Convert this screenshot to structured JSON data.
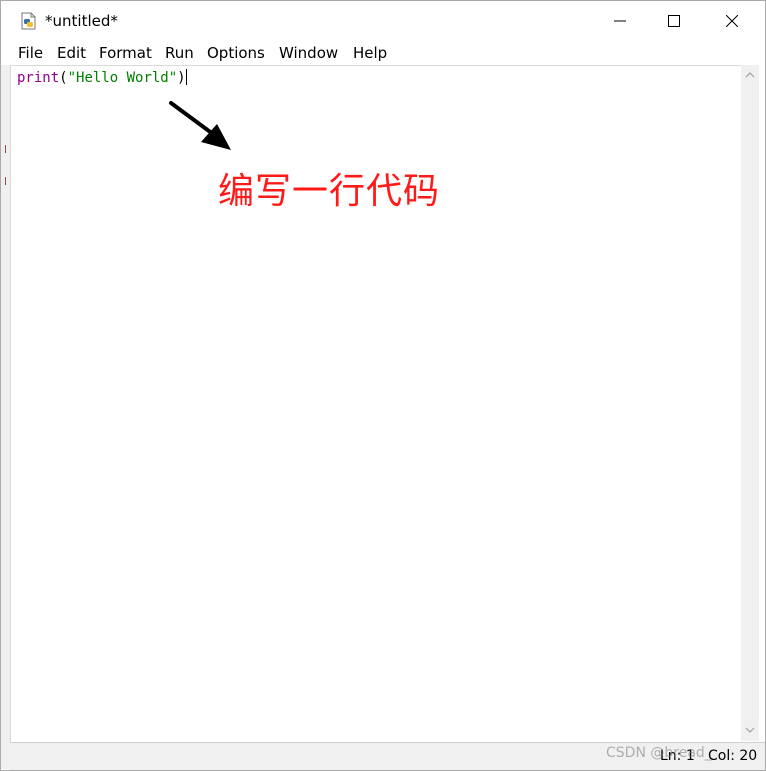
{
  "window": {
    "title": "*untitled*",
    "icon": "python-file-icon"
  },
  "window_controls": {
    "minimize": "minimize-icon",
    "maximize": "maximize-icon",
    "close": "close-icon"
  },
  "menubar": {
    "items": [
      {
        "label": "File"
      },
      {
        "label": "Edit"
      },
      {
        "label": "Format"
      },
      {
        "label": "Run"
      },
      {
        "label": "Options"
      },
      {
        "label": "Window"
      },
      {
        "label": "Help"
      }
    ]
  },
  "editor": {
    "line1": {
      "builtin": "print",
      "open_paren": "(",
      "string": "\"Hello World\"",
      "close_paren": ")"
    }
  },
  "annotation": {
    "text": "编写一行代码",
    "color": "#ff1a1a"
  },
  "statusbar": {
    "ln": "Ln: 1",
    "col": "Col: 20"
  },
  "watermark": "CSDN @bread_"
}
